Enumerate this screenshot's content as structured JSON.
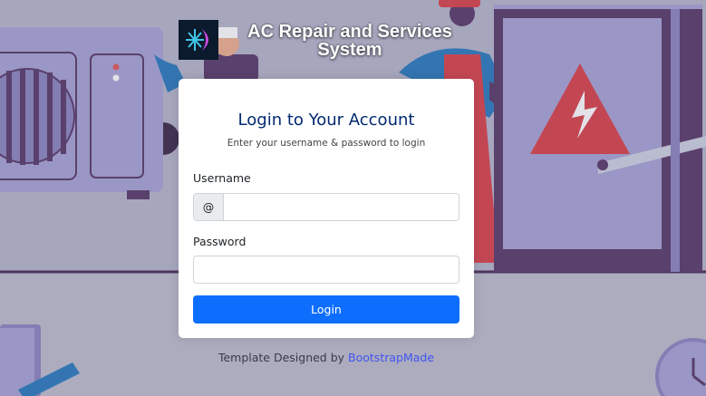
{
  "app": {
    "title": "AC Repair and Services System"
  },
  "login": {
    "heading": "Login to Your Account",
    "subheading": "Enter your username & password to login",
    "username_label": "Username",
    "username_addon": "@",
    "username_value": "",
    "password_label": "Password",
    "password_value": "",
    "submit_label": "Login"
  },
  "footer": {
    "prefix": "Template Designed by ",
    "link_text": "BootstrapMade"
  },
  "icons": {
    "logo": "snowflake-icon",
    "background": "ac-repair-illustration"
  },
  "colors": {
    "primary": "#0d6efd",
    "title": "#012970",
    "link": "#4154f1",
    "background": "#b3b3c8"
  }
}
